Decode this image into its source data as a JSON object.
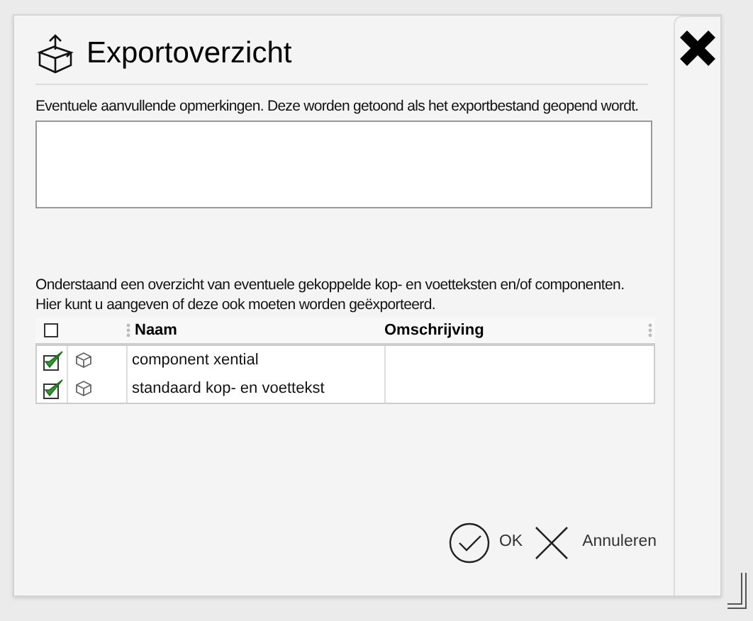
{
  "dialog": {
    "title": "Exportoverzicht"
  },
  "remarks": {
    "label": "Eventuele aanvullende opmerkingen. Deze worden getoond als het exportbestand geopend wordt."
  },
  "description": [
    "Onderstaand een overzicht van eventuele gekoppelde kop- en voetteksten en/of componenten.",
    "Hier kunt u aangeven of deze ook moeten worden geëxporteerd."
  ],
  "table": {
    "select_all": {
      "checked": false
    },
    "columns": [
      "Naam",
      "Omschrijving"
    ],
    "rows": [
      {
        "checked": true,
        "name": "component xential"
      },
      {
        "checked": true,
        "name": "standaard kop- en voettekst"
      }
    ]
  },
  "buttons": [
    {
      "kind": "ok",
      "label": "OK"
    },
    {
      "kind": "cancel",
      "label": "Annuleren"
    }
  ]
}
